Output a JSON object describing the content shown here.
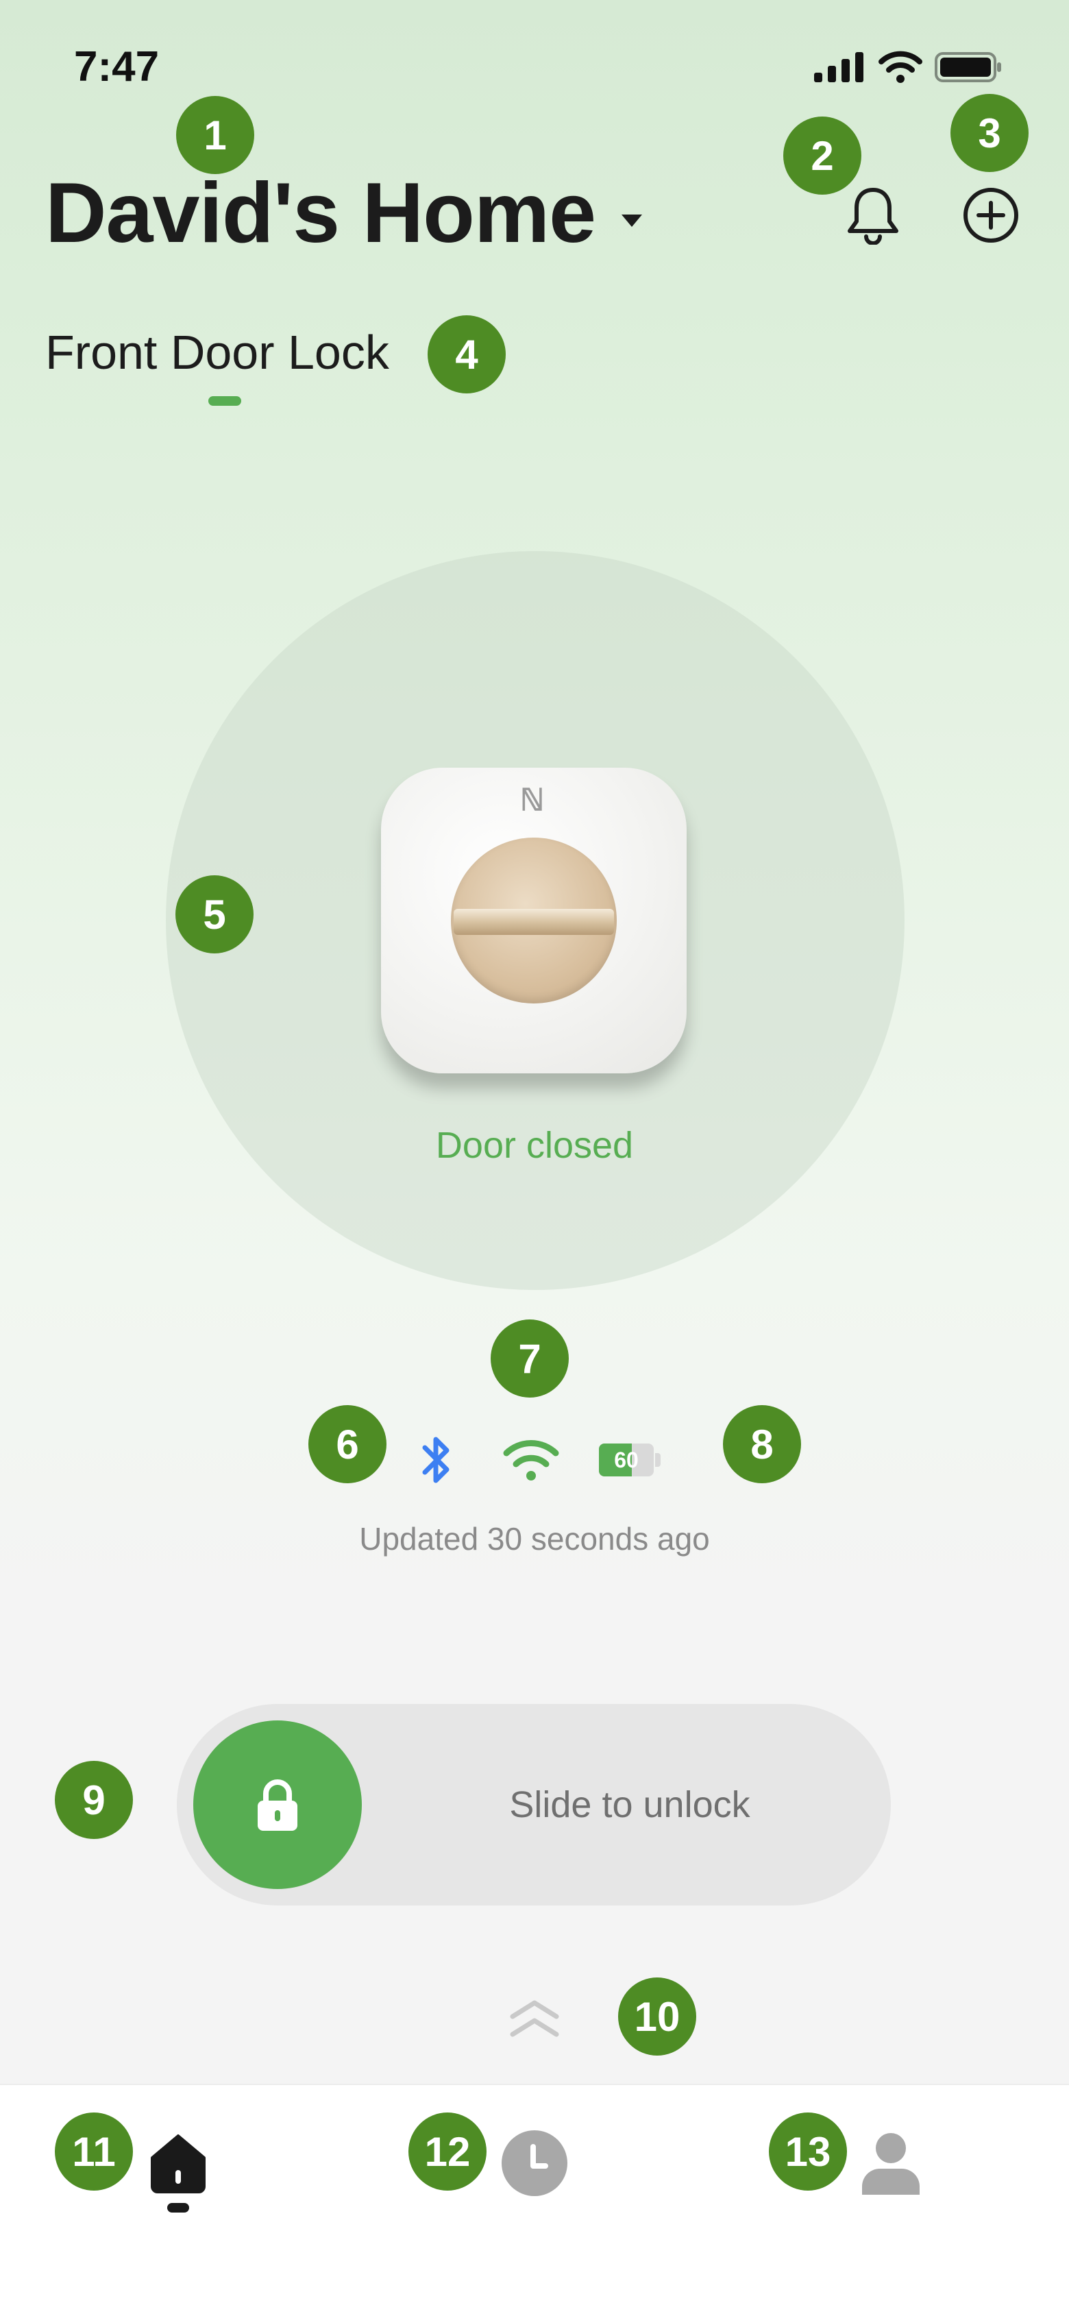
{
  "status_bar": {
    "time": "7:47"
  },
  "header": {
    "home_name": "David's Home"
  },
  "device_tab": {
    "label": "Front Door Lock"
  },
  "lock": {
    "door_status": "Door closed",
    "nfc_symbol": "ℕ"
  },
  "connectivity": {
    "bluetooth": "bluetooth-icon",
    "wifi": "wifi-icon",
    "battery_level": 60,
    "battery_label": "60",
    "updated_text": "Updated 30 seconds ago"
  },
  "slider": {
    "label": "Slide to unlock"
  },
  "tabs": [
    {
      "name": "home",
      "icon": "home-icon"
    },
    {
      "name": "history",
      "icon": "clock-icon"
    },
    {
      "name": "profile",
      "icon": "person-icon"
    }
  ],
  "annotations": [
    "1",
    "2",
    "3",
    "4",
    "5",
    "6",
    "7",
    "8",
    "9",
    "10",
    "11",
    "12",
    "13"
  ],
  "colors": {
    "accent": "#57ad52",
    "badge": "#4e8c24",
    "bluetooth": "#3d7ff2"
  }
}
